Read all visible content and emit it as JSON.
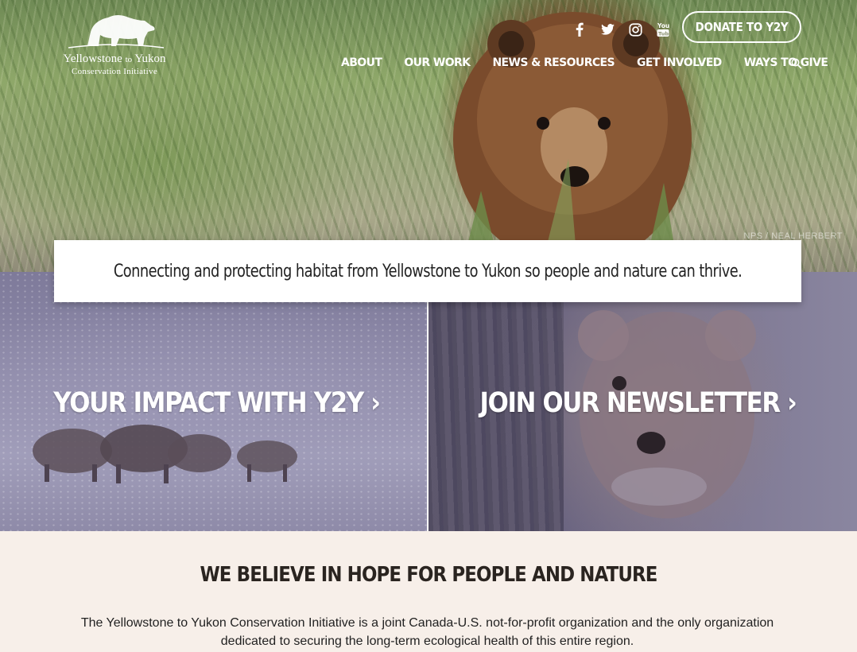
{
  "logo": {
    "name_part1": "Yellowstone",
    "name_to": "to",
    "name_part2": "Yukon",
    "subtitle": "Conservation Initiative",
    "icon": "bear-icon"
  },
  "social": [
    {
      "name": "facebook",
      "icon": "facebook-icon"
    },
    {
      "name": "twitter",
      "icon": "twitter-icon"
    },
    {
      "name": "instagram",
      "icon": "instagram-icon"
    },
    {
      "name": "youtube",
      "icon": "youtube-icon"
    }
  ],
  "donate_label": "DONATE TO Y2Y",
  "nav": {
    "items": [
      "ABOUT",
      "OUR WORK",
      "NEWS & RESOURCES",
      "GET INVOLVED",
      "WAYS TO GIVE"
    ],
    "search_icon": "search-icon"
  },
  "hero": {
    "credit": "NPS / NEAL HERBERT"
  },
  "tagline": "Connecting and protecting habitat from Yellowstone to Yukon so people and nature can thrive.",
  "tiles": {
    "left_label": "YOUR IMPACT WITH Y2Y ›",
    "right_label": "JOIN OUR NEWSLETTER ›"
  },
  "about": {
    "heading": "WE BELIEVE IN HOPE FOR PEOPLE AND NATURE",
    "body": "The Yellowstone to Yukon Conservation Initiative is a joint Canada-U.S. not-for-profit organization and the only organization dedicated to securing the long-term ecological health of this entire region."
  },
  "colors": {
    "page_bg": "#f7efe9",
    "tile_overlay": "#8a86a6",
    "text_dark": "#2a2420"
  }
}
